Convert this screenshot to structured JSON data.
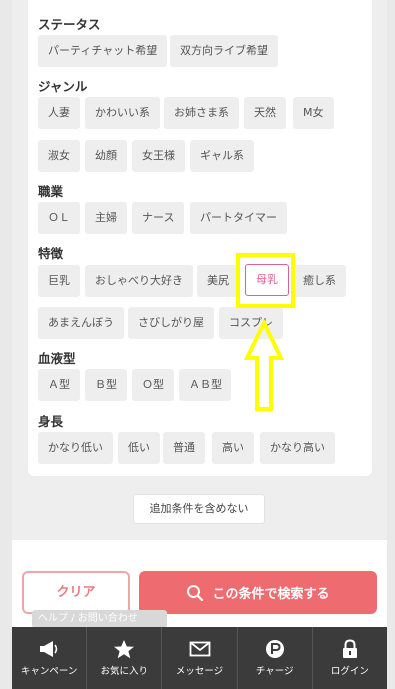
{
  "sections": {
    "status": {
      "title": "ステータス",
      "tags": [
        "パーティチャット希望",
        "双方向ライブ希望"
      ]
    },
    "genre": {
      "title": "ジャンル",
      "tags": [
        "人妻",
        "かわいい系",
        "お姉さま系",
        "天然",
        "M女",
        "淑女",
        "幼顔",
        "女王様",
        "ギャル系"
      ]
    },
    "job": {
      "title": "職業",
      "tags": [
        "ＯＬ",
        "主婦",
        "ナース",
        "パートタイマー"
      ]
    },
    "feature": {
      "title": "特徴",
      "tags": [
        "巨乳",
        "おしゃべり大好き",
        "美尻",
        "母乳",
        "癒し系",
        "あまえんぼう",
        "さびしがり屋",
        "コスプレ"
      ]
    },
    "blood": {
      "title": "血液型",
      "tags": [
        "Ａ型",
        "Ｂ型",
        "Ｏ型",
        "ＡＢ型"
      ]
    },
    "height": {
      "title": "身長",
      "tags": [
        "かなり低い",
        "低い",
        "普通",
        "高い",
        "かなり高い"
      ]
    }
  },
  "exclude_button": "追加条件を含めない",
  "clear_button": "クリア",
  "search_button": "この条件で検索する",
  "peek_text": "ヘルプ / お問い合わせ",
  "tabbar": {
    "items": [
      "キャンペーン",
      "お気に入り",
      "メッセージ",
      "チャージ",
      "ログイン"
    ]
  },
  "colors": {
    "accent": "#ee6b70",
    "selected": "#d6649a",
    "highlight": "#ffff00"
  }
}
